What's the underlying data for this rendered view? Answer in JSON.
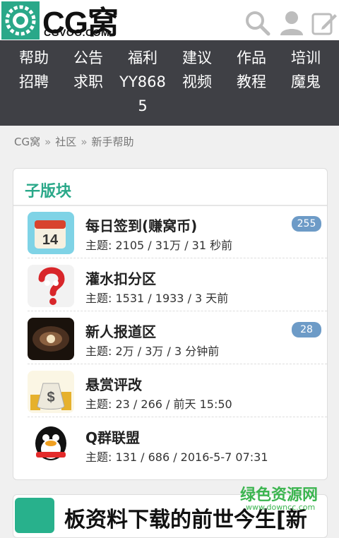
{
  "header": {
    "logo_text": "CG窝",
    "logo_sub": "CGVOO.COM"
  },
  "nav": {
    "row1": [
      "帮助",
      "公告",
      "福利",
      "建议",
      "作品",
      "培训"
    ],
    "row2": [
      "招聘",
      "求职",
      "YY868",
      "视频",
      "教程",
      "魔鬼"
    ],
    "row3_col3": "5"
  },
  "breadcrumb": [
    "CG窝",
    "社区",
    "新手帮助"
  ],
  "breadcrumb_sep": "»",
  "section": {
    "title": "子版块",
    "items": [
      {
        "name": "每日签到(赚窝币)",
        "meta": "主题:  2105 / 31万 / 31 秒前",
        "badge": "255",
        "icon": "calendar-icon"
      },
      {
        "name": "灌水扣分区",
        "meta": "主题:  1531 / 1933 / 3 天前",
        "badge": "",
        "icon": "question-mascot-icon"
      },
      {
        "name": "新人报道区",
        "meta": "主题:  2万 / 3万 / 3 分钟前",
        "badge": "28",
        "icon": "galaxy-icon"
      },
      {
        "name": "悬赏评改",
        "meta": "主题:  23 / 266 / 前天 15:50",
        "badge": "",
        "icon": "money-bag-icon"
      },
      {
        "name": "Q群联盟",
        "meta": "主题:  131 / 686 / 2016-5-7 07:31",
        "badge": "",
        "icon": "qq-penguin-icon"
      }
    ]
  },
  "next_card_text": "板资料下载的前世今生[新",
  "watermark": {
    "line1": "绿色资源网",
    "line2": "www.downcc.com"
  },
  "colors": {
    "accent": "#2aa889",
    "nav_bg": "#3f4045",
    "badge": "#6d9bc7"
  }
}
